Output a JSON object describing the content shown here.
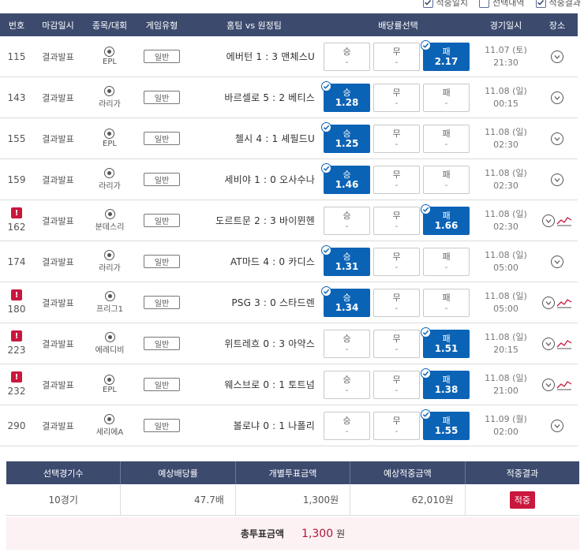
{
  "legend": [
    {
      "label": "적중일치",
      "checked": true
    },
    {
      "label": "선택내역",
      "checked": false
    },
    {
      "label": "적중결과",
      "checked": true
    }
  ],
  "headers": {
    "no": "번호",
    "deadline": "마감일시",
    "league": "종목/대회",
    "game_type": "게임유형",
    "match": "홈팀 vs 원정팀",
    "odds": "배당률선택",
    "time": "경기일시",
    "place": "장소"
  },
  "rows": [
    {
      "no": "115",
      "alert": false,
      "deadline": "결과발표",
      "league": "EPL",
      "game_type": "일반",
      "match": "에버턴 1 : 3 맨체스U",
      "odds": [
        {
          "label": "승",
          "value": "-"
        },
        {
          "label": "무",
          "value": "-"
        },
        {
          "label": "패",
          "value": "2.17"
        }
      ],
      "selected": 2,
      "date": "11.07 (토)",
      "clock": "21:30",
      "trend": false
    },
    {
      "no": "143",
      "alert": false,
      "deadline": "결과발표",
      "league": "라리가",
      "game_type": "일반",
      "match": "바르셀로 5 : 2 베티스",
      "odds": [
        {
          "label": "승",
          "value": "1.28"
        },
        {
          "label": "무",
          "value": "-"
        },
        {
          "label": "패",
          "value": "-"
        }
      ],
      "selected": 0,
      "date": "11.08 (일)",
      "clock": "00:15",
      "trend": false
    },
    {
      "no": "155",
      "alert": false,
      "deadline": "결과발표",
      "league": "EPL",
      "game_type": "일반",
      "match": "첼시 4 : 1 셰필드U",
      "odds": [
        {
          "label": "승",
          "value": "1.25"
        },
        {
          "label": "무",
          "value": "-"
        },
        {
          "label": "패",
          "value": "-"
        }
      ],
      "selected": 0,
      "date": "11.08 (일)",
      "clock": "02:30",
      "trend": false
    },
    {
      "no": "159",
      "alert": false,
      "deadline": "결과발표",
      "league": "라리가",
      "game_type": "일반",
      "match": "세비야 1 : 0 오사수나",
      "odds": [
        {
          "label": "승",
          "value": "1.46"
        },
        {
          "label": "무",
          "value": "-"
        },
        {
          "label": "패",
          "value": "-"
        }
      ],
      "selected": 0,
      "date": "11.08 (일)",
      "clock": "02:30",
      "trend": false
    },
    {
      "no": "162",
      "alert": true,
      "deadline": "결과발표",
      "league": "분데스리",
      "game_type": "일반",
      "match": "도르트문 2 : 3 바이뮌헨",
      "odds": [
        {
          "label": "승",
          "value": "-"
        },
        {
          "label": "무",
          "value": "-"
        },
        {
          "label": "패",
          "value": "1.66"
        }
      ],
      "selected": 2,
      "date": "11.08 (일)",
      "clock": "02:30",
      "trend": true
    },
    {
      "no": "174",
      "alert": false,
      "deadline": "결과발표",
      "league": "라리가",
      "game_type": "일반",
      "match": "AT마드 4 : 0 카디스",
      "odds": [
        {
          "label": "승",
          "value": "1.31"
        },
        {
          "label": "무",
          "value": "-"
        },
        {
          "label": "패",
          "value": "-"
        }
      ],
      "selected": 0,
      "date": "11.08 (일)",
      "clock": "05:00",
      "trend": false
    },
    {
      "no": "180",
      "alert": true,
      "deadline": "결과발표",
      "league": "프리그1",
      "game_type": "일반",
      "match": "PSG 3 : 0 스타드렌",
      "odds": [
        {
          "label": "승",
          "value": "1.34"
        },
        {
          "label": "무",
          "value": "-"
        },
        {
          "label": "패",
          "value": "-"
        }
      ],
      "selected": 0,
      "date": "11.08 (일)",
      "clock": "05:00",
      "trend": true
    },
    {
      "no": "223",
      "alert": true,
      "deadline": "결과발표",
      "league": "에레디비",
      "game_type": "일반",
      "match": "위트레흐 0 : 3 아약스",
      "odds": [
        {
          "label": "승",
          "value": "-"
        },
        {
          "label": "무",
          "value": "-"
        },
        {
          "label": "패",
          "value": "1.51"
        }
      ],
      "selected": 2,
      "date": "11.08 (일)",
      "clock": "20:15",
      "trend": true
    },
    {
      "no": "232",
      "alert": true,
      "deadline": "결과발표",
      "league": "EPL",
      "game_type": "일반",
      "match": "웨스브로 0 : 1 토트넘",
      "odds": [
        {
          "label": "승",
          "value": "-"
        },
        {
          "label": "무",
          "value": "-"
        },
        {
          "label": "패",
          "value": "1.38"
        }
      ],
      "selected": 2,
      "date": "11.08 (일)",
      "clock": "21:00",
      "trend": true
    },
    {
      "no": "290",
      "alert": false,
      "deadline": "결과발표",
      "league": "세리에A",
      "game_type": "일반",
      "match": "볼로냐 0 : 1 나폴리",
      "odds": [
        {
          "label": "승",
          "value": "-"
        },
        {
          "label": "무",
          "value": "-"
        },
        {
          "label": "패",
          "value": "1.55"
        }
      ],
      "selected": 2,
      "date": "11.09 (월)",
      "clock": "02:00",
      "trend": false
    }
  ],
  "summary": {
    "headers": [
      "선택경기수",
      "예상배당률",
      "개별투표금액",
      "예상적중금액",
      "적중결과"
    ],
    "games": "10경기",
    "odds": "47.7배",
    "bet": "1,300원",
    "expected": "62,010원",
    "result": "적중"
  },
  "total": {
    "label": "총투표금액",
    "value": "1,300",
    "unit": "원"
  },
  "colors": {
    "header": "#3c4a6e",
    "selected": "#0b63b6",
    "alert": "#c9173d"
  },
  "icons": {
    "alert": "alert-icon",
    "ball": "soccer-ball-icon",
    "pin": "location-pin-icon",
    "trend": "trend-chart-icon",
    "check": "check-icon"
  }
}
